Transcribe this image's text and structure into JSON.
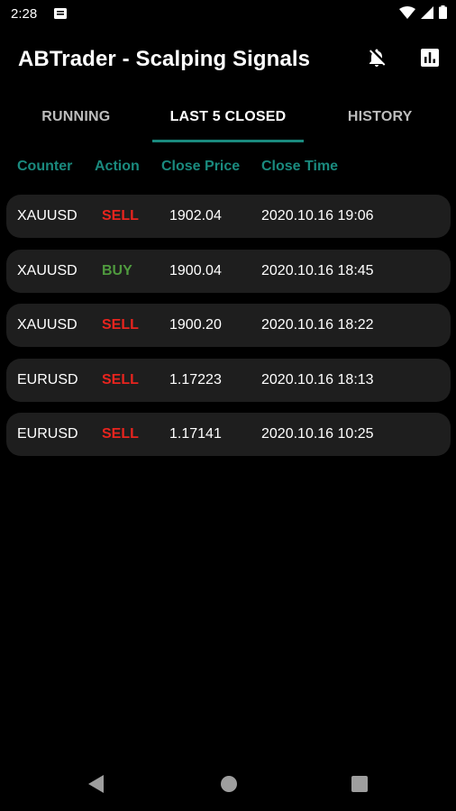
{
  "status_bar": {
    "time": "2:28",
    "icons": [
      "notification-icon",
      "wifi-icon",
      "signal-icon",
      "battery-icon"
    ]
  },
  "app_bar": {
    "title": "ABTrader - Scalping Signals",
    "actions": [
      "notifications-off-icon",
      "stats-icon"
    ]
  },
  "tabs": [
    {
      "label": "RUNNING",
      "active": false
    },
    {
      "label": "LAST 5 CLOSED",
      "active": true
    },
    {
      "label": "HISTORY",
      "active": false
    }
  ],
  "columns": {
    "counter": "Counter",
    "action": "Action",
    "close_price": "Close Price",
    "close_time": "Close Time"
  },
  "rows": [
    {
      "counter": "XAUUSD",
      "action": "SELL",
      "close_price": "1902.04",
      "close_time": "2020.10.16 19:06"
    },
    {
      "counter": "XAUUSD",
      "action": "BUY",
      "close_price": "1900.04",
      "close_time": "2020.10.16 18:45"
    },
    {
      "counter": "XAUUSD",
      "action": "SELL",
      "close_price": "1900.20",
      "close_time": "2020.10.16 18:22"
    },
    {
      "counter": "EURUSD",
      "action": "SELL",
      "close_price": "1.17223",
      "close_time": "2020.10.16 18:13"
    },
    {
      "counter": "EURUSD",
      "action": "SELL",
      "close_price": "1.17141",
      "close_time": "2020.10.16 10:25"
    }
  ],
  "colors": {
    "accent": "#1a8a7e",
    "sell": "#e8241e",
    "buy": "#4f9a3e",
    "row_bg": "#1e1e1e",
    "background": "#000000"
  },
  "nav_bar": {
    "icons": [
      "back-icon",
      "home-icon",
      "recents-icon"
    ]
  }
}
